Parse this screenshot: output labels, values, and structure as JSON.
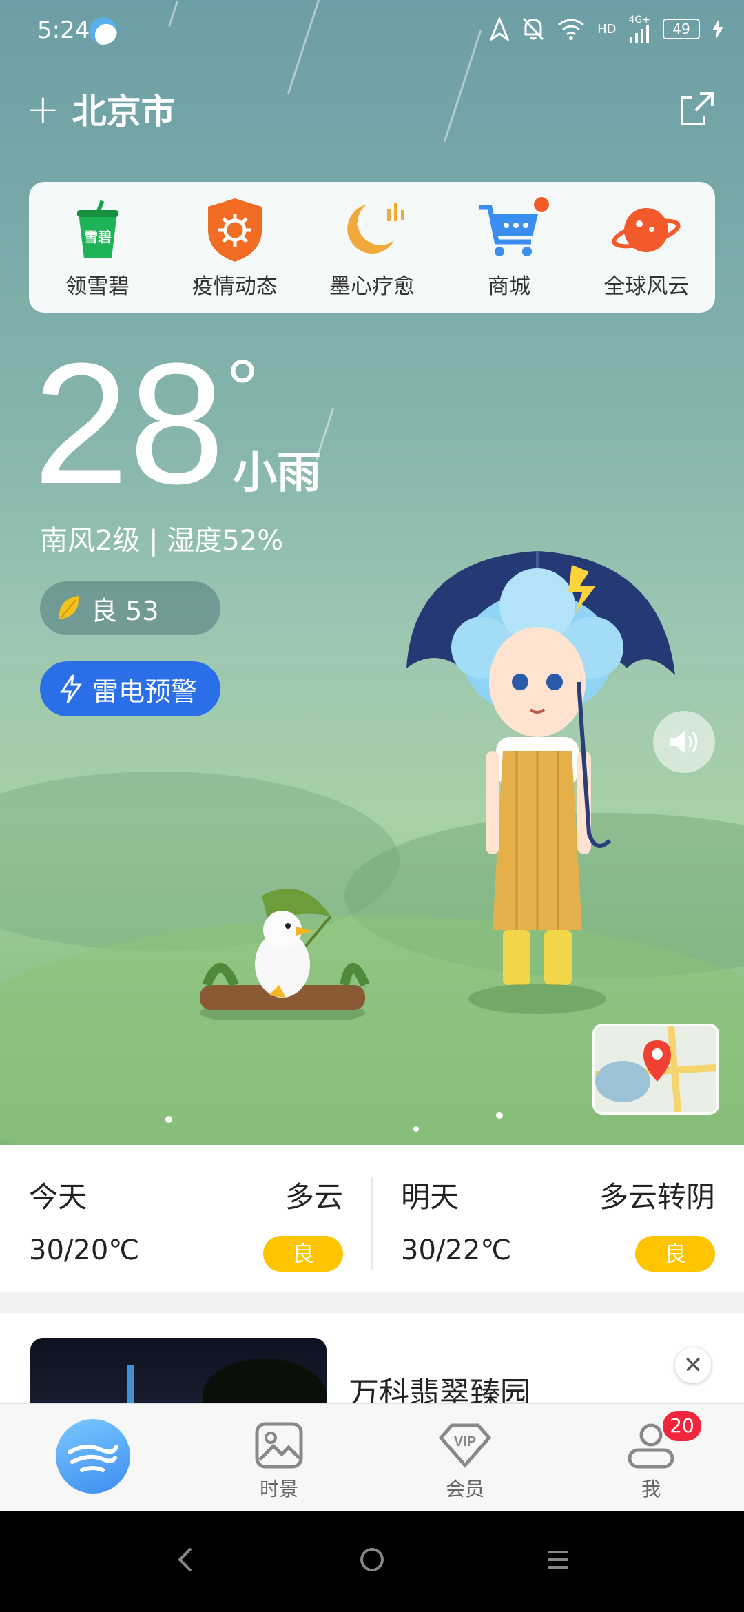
{
  "status_bar": {
    "time": "5:24",
    "network": "4G+",
    "hd": "HD",
    "battery": "49"
  },
  "header": {
    "city": "北京市"
  },
  "quick_menu": [
    {
      "label": "领雪碧",
      "icon": "sprite-cup-icon"
    },
    {
      "label": "疫情动态",
      "icon": "virus-shield-icon"
    },
    {
      "label": "墨心疗愈",
      "icon": "moon-icon"
    },
    {
      "label": "商城",
      "icon": "shopping-cart-icon"
    },
    {
      "label": "全球风云",
      "icon": "planet-icon"
    }
  ],
  "current": {
    "temperature": "28",
    "degree": "°",
    "condition": "小雨",
    "wind_humidity": "南风2级 | 湿度52%",
    "aqi": "良 53",
    "warning": "雷电预警"
  },
  "forecast": [
    {
      "day": "今天",
      "weather": "多云",
      "range": "30/20℃",
      "aqi": "良"
    },
    {
      "day": "明天",
      "weather": "多云转阴",
      "range": "30/22℃",
      "aqi": "良"
    }
  ],
  "news": {
    "title": "万科翡翠臻园"
  },
  "tabbar": [
    {
      "label": "",
      "icon": "weather-home-icon"
    },
    {
      "label": "时景",
      "icon": "photo-icon"
    },
    {
      "label": "会员",
      "icon": "vip-icon"
    },
    {
      "label": "我",
      "icon": "profile-icon",
      "badge": "20"
    }
  ],
  "colors": {
    "accent_blue": "#2a6fe8",
    "aqi_badge": "#ffc400",
    "badge_red": "#f0243a"
  }
}
